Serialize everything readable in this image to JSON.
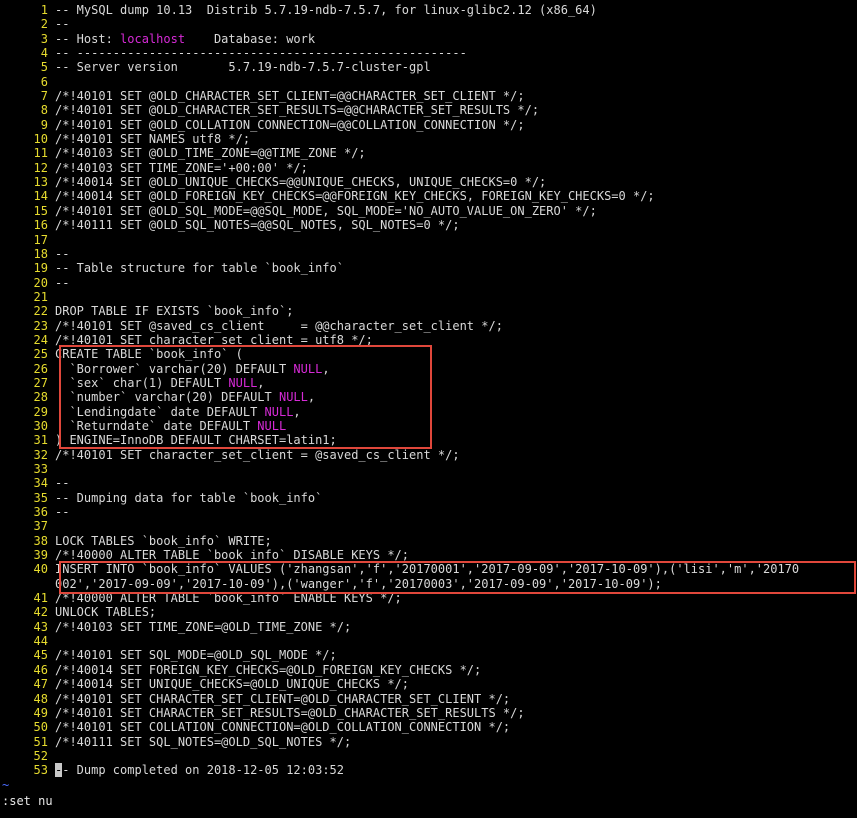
{
  "editor": {
    "lines": [
      {
        "n": "1",
        "text": "-- MySQL dump 10.13  Distrib 5.7.19-ndb-7.5.7, for linux-glibc2.12 (x86_64)"
      },
      {
        "n": "2",
        "text": "--"
      },
      {
        "n": "3",
        "text": "-- Host: localhost    Database: work"
      },
      {
        "n": "4",
        "text": "-- ------------------------------------------------------"
      },
      {
        "n": "5",
        "text": "-- Server version\t5.7.19-ndb-7.5.7-cluster-gpl"
      },
      {
        "n": "6",
        "text": ""
      },
      {
        "n": "7",
        "text": "/*!40101 SET @OLD_CHARACTER_SET_CLIENT=@@CHARACTER_SET_CLIENT */;"
      },
      {
        "n": "8",
        "text": "/*!40101 SET @OLD_CHARACTER_SET_RESULTS=@@CHARACTER_SET_RESULTS */;"
      },
      {
        "n": "9",
        "text": "/*!40101 SET @OLD_COLLATION_CONNECTION=@@COLLATION_CONNECTION */;"
      },
      {
        "n": "10",
        "text": "/*!40101 SET NAMES utf8 */;"
      },
      {
        "n": "11",
        "text": "/*!40103 SET @OLD_TIME_ZONE=@@TIME_ZONE */;"
      },
      {
        "n": "12",
        "text": "/*!40103 SET TIME_ZONE='+00:00' */;"
      },
      {
        "n": "13",
        "text": "/*!40014 SET @OLD_UNIQUE_CHECKS=@@UNIQUE_CHECKS, UNIQUE_CHECKS=0 */;"
      },
      {
        "n": "14",
        "text": "/*!40014 SET @OLD_FOREIGN_KEY_CHECKS=@@FOREIGN_KEY_CHECKS, FOREIGN_KEY_CHECKS=0 */;"
      },
      {
        "n": "15",
        "text": "/*!40101 SET @OLD_SQL_MODE=@@SQL_MODE, SQL_MODE='NO_AUTO_VALUE_ON_ZERO' */;"
      },
      {
        "n": "16",
        "text": "/*!40111 SET @OLD_SQL_NOTES=@@SQL_NOTES, SQL_NOTES=0 */;"
      },
      {
        "n": "17",
        "text": ""
      },
      {
        "n": "18",
        "text": "--"
      },
      {
        "n": "19",
        "text": "-- Table structure for table `book_info`"
      },
      {
        "n": "20",
        "text": "--"
      },
      {
        "n": "21",
        "text": ""
      },
      {
        "n": "22",
        "text": "DROP TABLE IF EXISTS `book_info`;"
      },
      {
        "n": "23",
        "text": "/*!40101 SET @saved_cs_client     = @@character_set_client */;"
      },
      {
        "n": "24",
        "text": "/*!40101 SET character_set_client = utf8 */;"
      },
      {
        "n": "25",
        "text": "CREATE TABLE `book_info` ("
      },
      {
        "n": "26",
        "text": "  `Borrower` varchar(20) DEFAULT NULL,"
      },
      {
        "n": "27",
        "text": "  `sex` char(1) DEFAULT NULL,"
      },
      {
        "n": "28",
        "text": "  `number` varchar(20) DEFAULT NULL,"
      },
      {
        "n": "29",
        "text": "  `Lendingdate` date DEFAULT NULL,"
      },
      {
        "n": "30",
        "text": "  `Returndate` date DEFAULT NULL"
      },
      {
        "n": "31",
        "text": ") ENGINE=InnoDB DEFAULT CHARSET=latin1;"
      },
      {
        "n": "32",
        "text": "/*!40101 SET character_set_client = @saved_cs_client */;"
      },
      {
        "n": "33",
        "text": ""
      },
      {
        "n": "34",
        "text": "--"
      },
      {
        "n": "35",
        "text": "-- Dumping data for table `book_info`"
      },
      {
        "n": "36",
        "text": "--"
      },
      {
        "n": "37",
        "text": ""
      },
      {
        "n": "38",
        "text": "LOCK TABLES `book_info` WRITE;"
      },
      {
        "n": "39",
        "text": "/*!40000 ALTER TABLE `book_info` DISABLE KEYS */;"
      },
      {
        "n": "40",
        "text": "INSERT INTO `book_info` VALUES ('zhangsan','f','20170001','2017-09-09','2017-10-09'),('lisi','m','20170"
      },
      {
        "n": "",
        "text": "002','2017-09-09','2017-10-09'),('wanger','f','20170003','2017-09-09','2017-10-09');"
      },
      {
        "n": "41",
        "text": "/*!40000 ALTER TABLE `book_info` ENABLE KEYS */;"
      },
      {
        "n": "42",
        "text": "UNLOCK TABLES;"
      },
      {
        "n": "43",
        "text": "/*!40103 SET TIME_ZONE=@OLD_TIME_ZONE */;"
      },
      {
        "n": "44",
        "text": ""
      },
      {
        "n": "45",
        "text": "/*!40101 SET SQL_MODE=@OLD_SQL_MODE */;"
      },
      {
        "n": "46",
        "text": "/*!40014 SET FOREIGN_KEY_CHECKS=@OLD_FOREIGN_KEY_CHECKS */;"
      },
      {
        "n": "47",
        "text": "/*!40014 SET UNIQUE_CHECKS=@OLD_UNIQUE_CHECKS */;"
      },
      {
        "n": "48",
        "text": "/*!40101 SET CHARACTER_SET_CLIENT=@OLD_CHARACTER_SET_CLIENT */;"
      },
      {
        "n": "49",
        "text": "/*!40101 SET CHARACTER_SET_RESULTS=@OLD_CHARACTER_SET_RESULTS */;"
      },
      {
        "n": "50",
        "text": "/*!40101 SET COLLATION_CONNECTION=@OLD_COLLATION_CONNECTION */;"
      },
      {
        "n": "51",
        "text": "/*!40111 SET SQL_NOTES=@OLD_SQL_NOTES */;"
      },
      {
        "n": "52",
        "text": ""
      },
      {
        "n": "53",
        "text": "-- Dump completed on 2018-12-05 12:03:52"
      }
    ],
    "highlight_words": [
      "NULL",
      "localhost"
    ],
    "tilde": "~",
    "command_line": ":set nu"
  },
  "colors": {
    "background": "#000000",
    "text": "#d9d9d9",
    "line_number": "#e6db2e",
    "keyword_magenta": "#d62ad6",
    "annotation_box": "#e0473b",
    "tilde": "#4a6bff"
  }
}
